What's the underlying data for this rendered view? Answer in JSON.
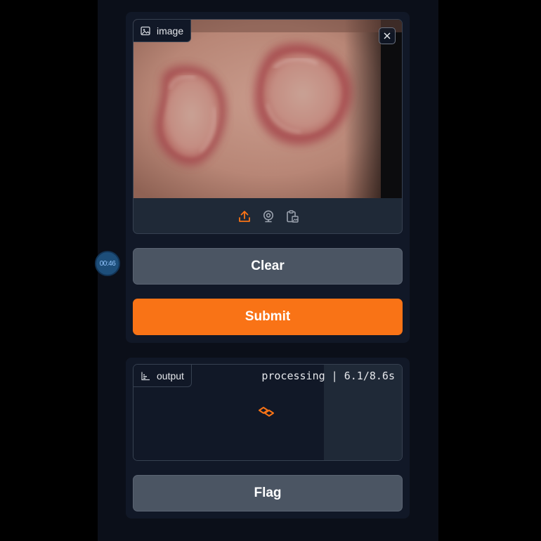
{
  "input": {
    "label": "image",
    "image_description_icon": "image-icon",
    "close_icon": "close-icon",
    "toolbar": [
      "upload-icon",
      "webcam-icon",
      "clipboard-paste-icon"
    ]
  },
  "buttons": {
    "clear": "Clear",
    "submit": "Submit",
    "flag": "Flag"
  },
  "output": {
    "label": "output",
    "icon": "bar-chart-icon",
    "status_text": "processing | 6.1/8.6s",
    "progress_fraction": 0.709
  },
  "timer": {
    "text": "00:46"
  },
  "colors": {
    "accent": "#f97316",
    "background": "#0b0f19",
    "panel": "#111827",
    "block": "#1f2937",
    "border": "#374151",
    "secondary_button": "#4b5563"
  }
}
